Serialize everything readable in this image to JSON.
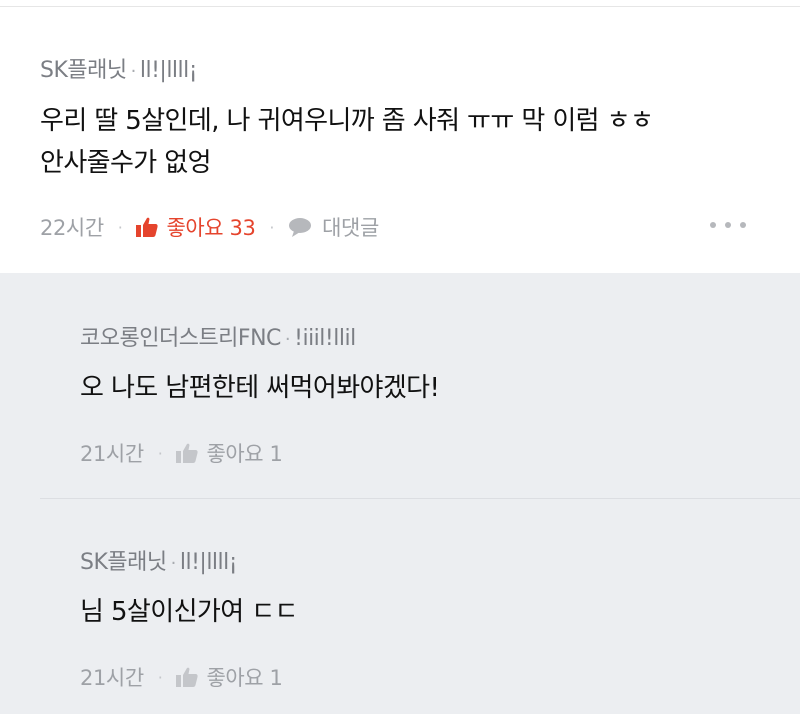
{
  "main_comment": {
    "author": "SK플래닛",
    "user_tag": "ll!|llll¡",
    "text_line1": "우리 딸 5살인데, 나 귀여우니까 좀 사줘 ㅠㅠ 막 이럼 ㅎㅎ",
    "text_line2": "안사줄수가 없엉",
    "time": "22시간",
    "like_label": "좋아요 33",
    "reply_label": "대댓글"
  },
  "replies": [
    {
      "author": "코오롱인더스트리FNC",
      "user_tag": "!iiil!llil",
      "text": "오 나도 남편한테 써먹어봐야겠다!",
      "time": "21시간",
      "like_label": "좋아요 1"
    },
    {
      "author": "SK플래닛",
      "user_tag": "ll!|llll¡",
      "text": "님 5살이신가여 ㄷㄷ",
      "time": "21시간",
      "like_label": "좋아요 1"
    }
  ],
  "colors": {
    "liked": "#e5442d",
    "meta": "#9ea1a6",
    "reply_bg": "#eceef1"
  },
  "icons": {
    "like": "thumbs-up-icon",
    "reply": "speech-bubble-icon",
    "more": "more-dots-icon"
  }
}
